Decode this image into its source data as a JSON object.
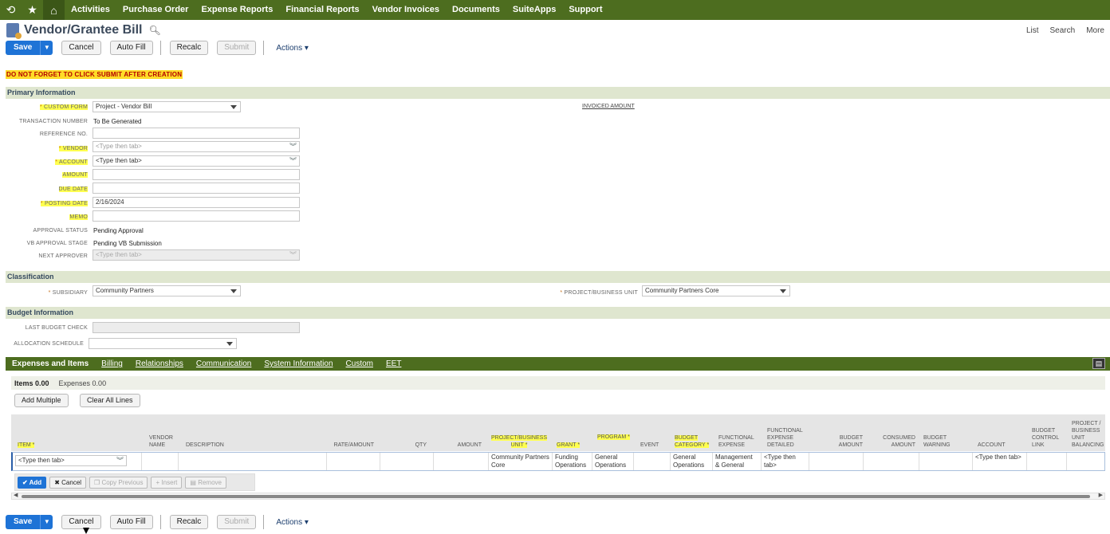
{
  "nav": {
    "items": [
      "Activities",
      "Purchase Order",
      "Expense Reports",
      "Financial Reports",
      "Vendor Invoices",
      "Documents",
      "SuiteApps",
      "Support"
    ]
  },
  "page": {
    "title": "Vendor/Grantee Bill",
    "links": [
      "List",
      "Search",
      "More"
    ]
  },
  "toolbar": {
    "save": "Save",
    "cancel": "Cancel",
    "autofill": "Auto Fill",
    "recalc": "Recalc",
    "submit": "Submit",
    "actions": "Actions"
  },
  "warning": "DO NOT FORGET TO CLICK SUBMIT AFTER CREATION",
  "primary": {
    "header": "Primary Information",
    "custom_form_label": "CUSTOM FORM",
    "custom_form_value": "Project - Vendor Bill",
    "invoiced_amount_label": "INVOICED AMOUNT",
    "transaction_number_label": "TRANSACTION NUMBER",
    "transaction_number_value": "To Be Generated",
    "reference_label": "REFERENCE NO.",
    "vendor_label": "VENDOR",
    "vendor_placeholder": "<Type then tab>",
    "account_label": "ACCOUNT",
    "account_value": "<Type then tab>",
    "amount_label": "AMOUNT",
    "due_date_label": "DUE DATE",
    "posting_date_label": "POSTING DATE",
    "posting_date_value": "2/16/2024",
    "memo_label": "MEMO",
    "approval_status_label": "APPROVAL STATUS",
    "approval_status_value": "Pending Approval",
    "vb_stage_label": "VB APPROVAL STAGE",
    "vb_stage_value": "Pending VB Submission",
    "next_approver_label": "NEXT APPROVER",
    "next_approver_placeholder": "<Type then tab>"
  },
  "classification": {
    "header": "Classification",
    "subsidiary_label": "SUBSIDIARY",
    "subsidiary_value": "Community Partners",
    "project_label": "PROJECT/BUSINESS UNIT",
    "project_value": "Community Partners Core"
  },
  "budget": {
    "header": "Budget Information",
    "last_check_label": "LAST BUDGET CHECK",
    "allocation_label": "ALLOCATION SCHEDULE"
  },
  "tabs": [
    "Expenses and Items",
    "Billing",
    "Relationships",
    "Communication",
    "System Information",
    "Custom",
    "EET"
  ],
  "subtabs": {
    "items": "Items 0.00",
    "expenses": "Expenses 0.00"
  },
  "list_buttons": {
    "add_multiple": "Add Multiple",
    "clear_all": "Clear All Lines"
  },
  "columns": {
    "item": "ITEM *",
    "vendor_name": "VENDOR NAME",
    "description": "DESCRIPTION",
    "rate": "RATE/AMOUNT",
    "qty": "QTY",
    "amount": "AMOUNT",
    "project_unit": "PROJECT/BUSINESS UNIT *",
    "grant": "GRANT *",
    "program": "PROGRAM *",
    "event": "EVENT",
    "budget_category": "BUDGET CATEGORY *",
    "functional_expense": "FUNCTIONAL EXPENSE",
    "functional_expense_detailed": "FUNCTIONAL EXPENSE DETAILED",
    "budget_amount": "BUDGET AMOUNT",
    "consumed_amount": "CONSUMED AMOUNT",
    "budget_warning": "BUDGET WARNING",
    "account": "ACCOUNT",
    "budget_control_link": "BUDGET CONTROL LINK",
    "project_balancing": "PROJECT / BUSINESS UNIT BALANCING"
  },
  "row": {
    "item": "<Type then tab>",
    "project_unit": "Community Partners Core",
    "grant": "Funding Operations",
    "program": "General Operations",
    "budget_category": "General Operations",
    "functional_expense": "Management & General",
    "functional_expense_detailed": "<Type then tab>",
    "account": "<Type then tab>"
  },
  "row_buttons": {
    "add": "Add",
    "cancel": "Cancel",
    "copy_previous": "Copy Previous",
    "insert": "Insert",
    "remove": "Remove"
  },
  "colors": {
    "nav": "#4d6d1f",
    "section": "#dfe6cf",
    "highlight": "#ffff50",
    "primary_btn": "#1e73d6"
  }
}
